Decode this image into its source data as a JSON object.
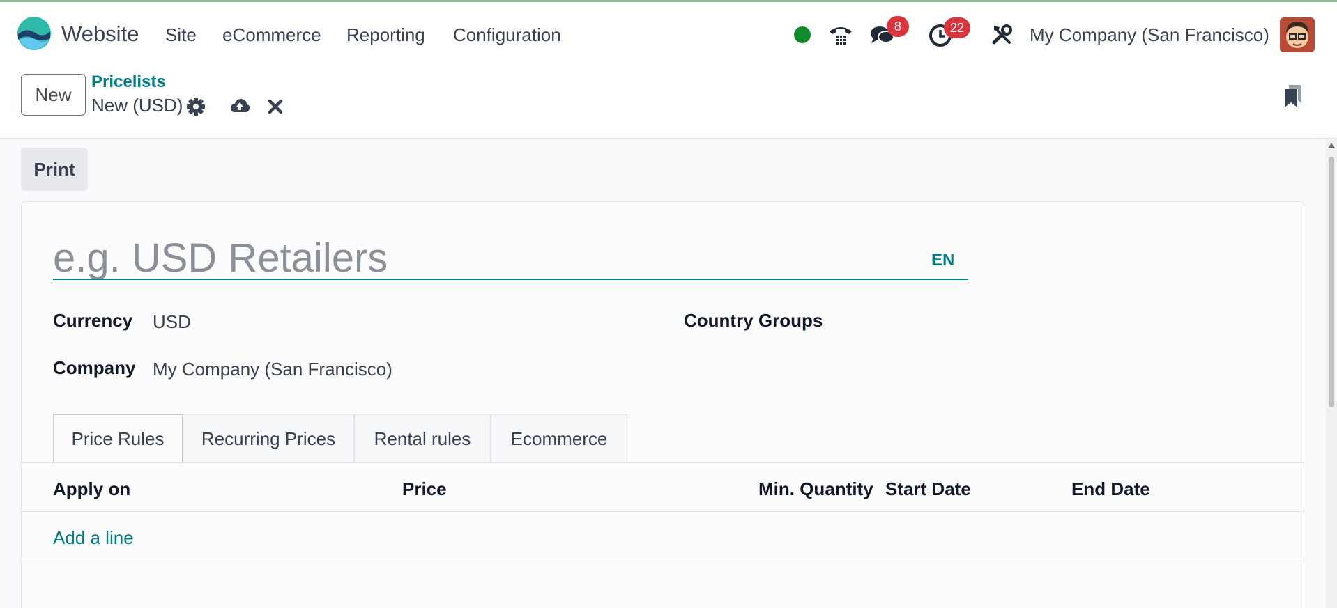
{
  "navbar": {
    "app_name": "Website",
    "menu": [
      "Site",
      "eCommerce",
      "Reporting",
      "Configuration"
    ],
    "messages_count": "8",
    "activities_count": "22",
    "company": "My Company (San Francisco)",
    "icons": [
      "status-online-icon",
      "phone-icon",
      "chat-icon",
      "clock-icon",
      "tools-icon"
    ]
  },
  "control": {
    "new_label": "New",
    "breadcrumb": "Pricelists",
    "record_name": "New (USD)"
  },
  "actions": {
    "print_label": "Print"
  },
  "form": {
    "name_placeholder": "e.g. USD Retailers",
    "lang": "EN",
    "currency_label": "Currency",
    "currency_value": "USD",
    "company_label": "Company",
    "company_value": "My Company (San Francisco)",
    "country_groups_label": "Country Groups"
  },
  "tabs": [
    "Price Rules",
    "Recurring Prices",
    "Rental rules",
    "Ecommerce"
  ],
  "list": {
    "columns": [
      "Apply on",
      "Price",
      "Min. Quantity",
      "Start Date",
      "End Date"
    ],
    "add_line": "Add a line"
  },
  "colors": {
    "accent": "#017e84",
    "badge": "#d9363e",
    "online": "#108a2a"
  }
}
